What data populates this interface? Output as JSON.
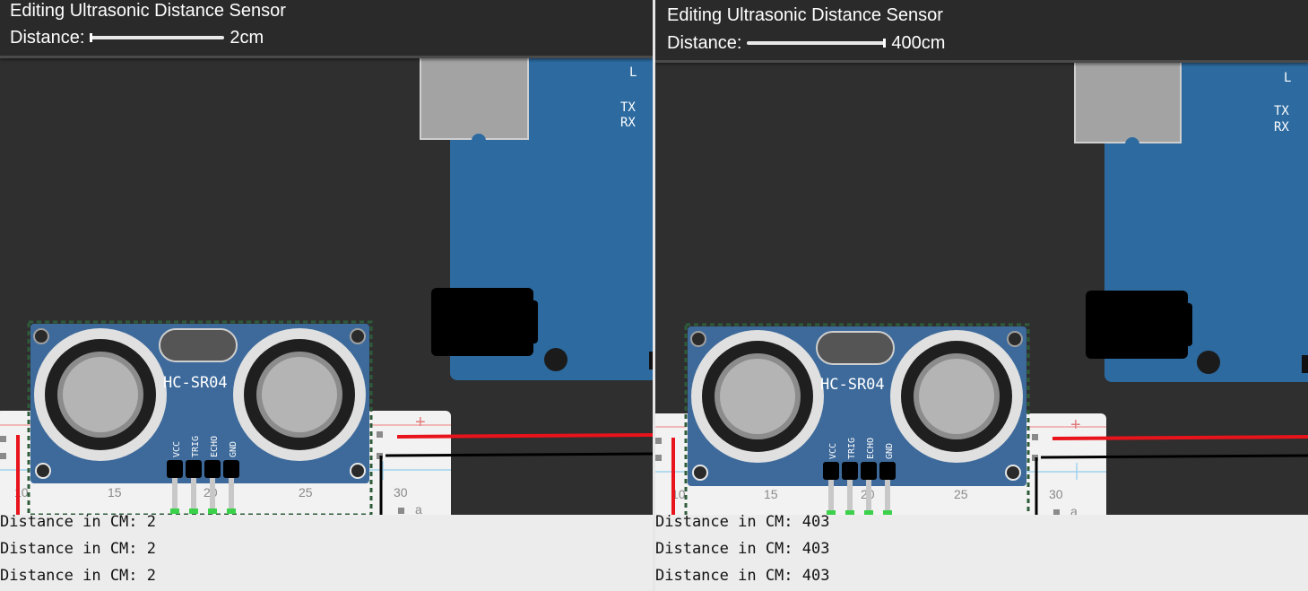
{
  "left": {
    "header": {
      "title": "Editing Ultrasonic Distance Sensor",
      "distance_label": "Distance:",
      "distance_value": "2cm"
    },
    "slider": {
      "value_cm": 2,
      "min_cm": 2,
      "max_cm": 400
    },
    "sensor": {
      "model": "HC-SR04",
      "pins": [
        "VCC",
        "TRIG",
        "ECHO",
        "GND"
      ]
    },
    "board": {
      "led_l": "L",
      "led_tx": "TX",
      "led_rx": "RX"
    },
    "breadboard": {
      "col_10": "10",
      "col_15": "15",
      "col_20": "20",
      "col_25": "25",
      "col_30": "30",
      "row_a": "a",
      "plus": "+"
    },
    "serial": {
      "lines": [
        "Distance in CM: 2",
        "Distance in CM: 2",
        "Distance in CM: 2"
      ]
    }
  },
  "right": {
    "header": {
      "title": "Editing Ultrasonic Distance Sensor",
      "distance_label": "Distance:",
      "distance_value": "400cm"
    },
    "slider": {
      "value_cm": 400,
      "min_cm": 2,
      "max_cm": 400
    },
    "sensor": {
      "model": "HC-SR04",
      "pins": [
        "VCC",
        "TRIG",
        "ECHO",
        "GND"
      ]
    },
    "board": {
      "led_l": "L",
      "led_tx": "TX",
      "led_rx": "RX"
    },
    "breadboard": {
      "col_10": "10",
      "col_15": "15",
      "col_20": "20",
      "col_25": "25",
      "col_30": "30",
      "row_a": "a",
      "plus": "+"
    },
    "serial": {
      "lines": [
        "Distance in CM: 403",
        "Distance in CM: 403",
        "Distance in CM: 403"
      ]
    }
  },
  "colors": {
    "canvas": "#2f2f2f",
    "sensor_board": "#3d6a9b",
    "arduino_board": "#2c6aa0",
    "wire_red": "#e8131b",
    "wire_black": "#000000"
  }
}
